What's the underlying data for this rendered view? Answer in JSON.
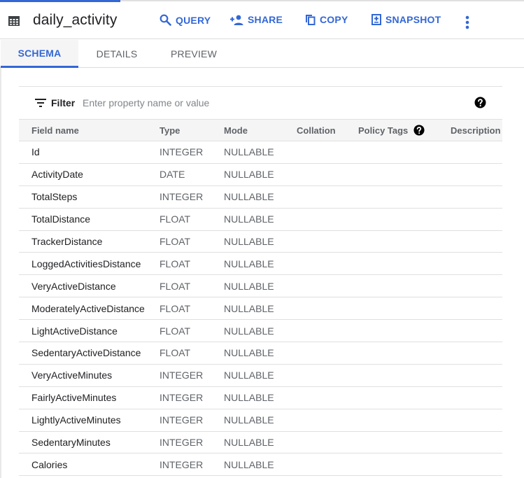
{
  "header": {
    "title": "daily_activity",
    "table_icon": "table-icon",
    "actions": [
      {
        "label": "QUERY",
        "icon": "search-icon"
      },
      {
        "label": "SHARE",
        "icon": "person-add-icon"
      },
      {
        "label": "COPY",
        "icon": "copy-icon"
      },
      {
        "label": "SNAPSHOT",
        "icon": "snapshot-icon"
      }
    ],
    "more_icon": "more-vert-icon"
  },
  "tabs": [
    {
      "label": "SCHEMA",
      "active": true
    },
    {
      "label": "DETAILS",
      "active": false
    },
    {
      "label": "PREVIEW",
      "active": false
    }
  ],
  "filter": {
    "label": "Filter",
    "placeholder": "Enter property name or value",
    "value": ""
  },
  "columns": {
    "field_name": "Field name",
    "type": "Type",
    "mode": "Mode",
    "collation": "Collation",
    "policy_tags": "Policy Tags",
    "description": "Description"
  },
  "rows": [
    {
      "name": "Id",
      "type": "INTEGER",
      "mode": "NULLABLE"
    },
    {
      "name": "ActivityDate",
      "type": "DATE",
      "mode": "NULLABLE"
    },
    {
      "name": "TotalSteps",
      "type": "INTEGER",
      "mode": "NULLABLE"
    },
    {
      "name": "TotalDistance",
      "type": "FLOAT",
      "mode": "NULLABLE"
    },
    {
      "name": "TrackerDistance",
      "type": "FLOAT",
      "mode": "NULLABLE"
    },
    {
      "name": "LoggedActivitiesDistance",
      "type": "FLOAT",
      "mode": "NULLABLE"
    },
    {
      "name": "VeryActiveDistance",
      "type": "FLOAT",
      "mode": "NULLABLE"
    },
    {
      "name": "ModeratelyActiveDistance",
      "type": "FLOAT",
      "mode": "NULLABLE"
    },
    {
      "name": "LightActiveDistance",
      "type": "FLOAT",
      "mode": "NULLABLE"
    },
    {
      "name": "SedentaryActiveDistance",
      "type": "FLOAT",
      "mode": "NULLABLE"
    },
    {
      "name": "VeryActiveMinutes",
      "type": "INTEGER",
      "mode": "NULLABLE"
    },
    {
      "name": "FairlyActiveMinutes",
      "type": "INTEGER",
      "mode": "NULLABLE"
    },
    {
      "name": "LightlyActiveMinutes",
      "type": "INTEGER",
      "mode": "NULLABLE"
    },
    {
      "name": "SedentaryMinutes",
      "type": "INTEGER",
      "mode": "NULLABLE"
    },
    {
      "name": "Calories",
      "type": "INTEGER",
      "mode": "NULLABLE"
    }
  ],
  "colors": {
    "accent": "#3367d6",
    "header_bg": "#f5f5f5",
    "divider": "#e0e0e0",
    "muted_text": "#5f6368"
  }
}
